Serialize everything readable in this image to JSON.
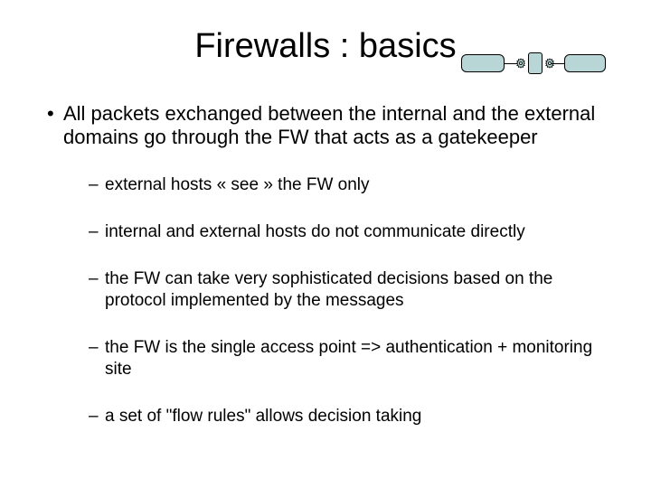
{
  "title": "Firewalls : basics",
  "bullet": {
    "marker": "•",
    "text": "All packets exchanged between the internal and the external domains go through the FW that acts as a gatekeeper"
  },
  "sub": {
    "marker": "–",
    "items": [
      "external hosts « see » the FW only",
      "internal and external hosts do not communicate directly",
      "the FW can take very sophisticated decisions based on the protocol implemented by the messages",
      "the FW is the single access point => authentication + monitoring site",
      "a set of \"flow rules\" allows decision taking"
    ]
  }
}
